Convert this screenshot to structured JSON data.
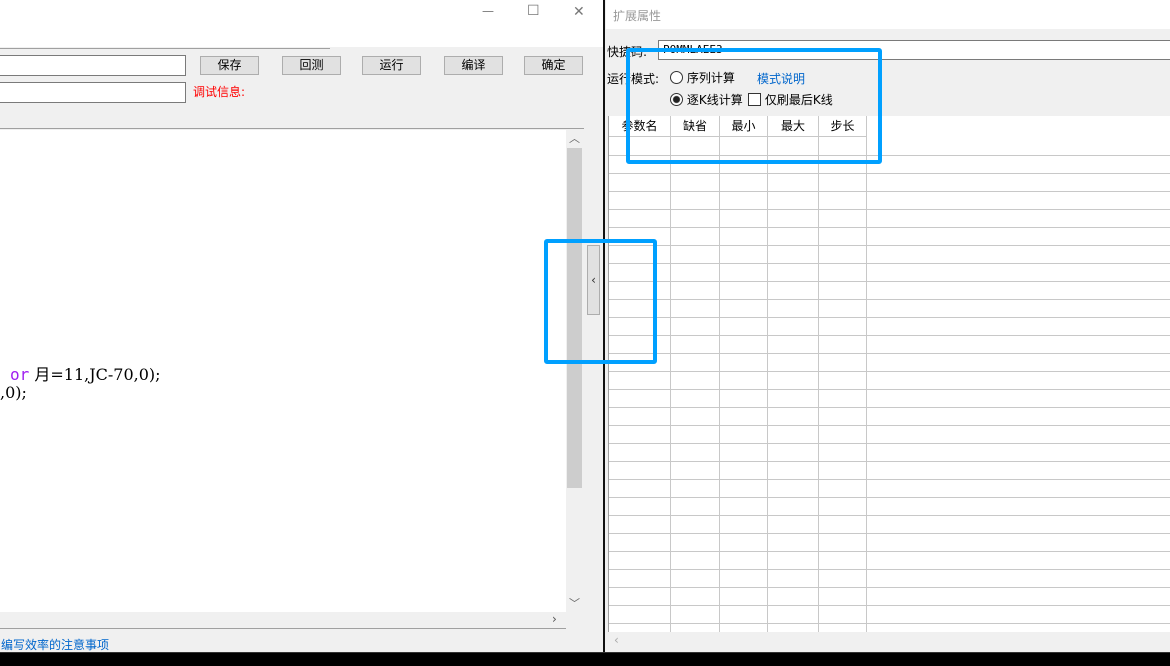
{
  "editor_window": {
    "window_controls": {
      "minimize": "—",
      "maximize": "☐",
      "close": "✕"
    },
    "toolbar": {
      "save": "保存",
      "backtest": "回测",
      "run": "运行",
      "compile": "编译",
      "confirm": "确定"
    },
    "debug_label": "调试信息:",
    "code_lines": [
      {
        "keyword": "or",
        "rest": " 月=11,JC-70,0);"
      },
      {
        "keyword": "",
        "rest": ",0);"
      }
    ],
    "status_link": "编写效率的注意事项"
  },
  "properties_panel": {
    "title": "扩展属性",
    "shortcut_label": "快捷码:",
    "shortcut_value": "POMMLAEE3",
    "run_mode_label": "运行模式:",
    "mode_options": [
      {
        "label": "序列计算",
        "selected": false
      },
      {
        "label": "逐K线计算",
        "selected": true
      }
    ],
    "mode_help_link": "模式说明",
    "refresh_last_only": {
      "label": "仅刷最后K线",
      "checked": false
    },
    "param_table": {
      "columns": [
        "参数名",
        "缺省",
        "最小",
        "最大",
        "步长"
      ],
      "rows": []
    }
  },
  "colors": {
    "highlight": "#00a0ff",
    "debug": "#ff0000",
    "link": "#0066cc",
    "keyword": "#a020f0"
  }
}
